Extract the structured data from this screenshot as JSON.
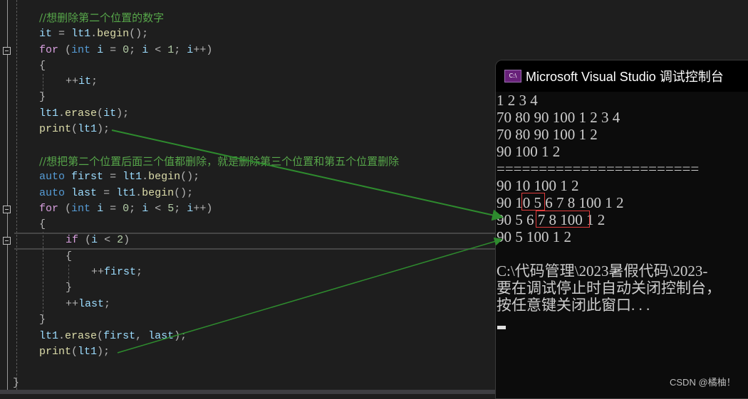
{
  "editor": {
    "lines": [
      {
        "comment": "//想删除第二个位置的数字"
      },
      {
        "code": "it = lt1.begin();"
      },
      {
        "code": "for (int i = 0; i < 1; i++)"
      },
      {
        "code": "{"
      },
      {
        "code": "++it;"
      },
      {
        "code": "}"
      },
      {
        "code": "lt1.erase(it);"
      },
      {
        "code": "print(lt1);"
      },
      {
        "code": ""
      },
      {
        "comment": "//想把第二个位置后面三个值都删除，就是删除第三个位置和第五个位置删除"
      },
      {
        "code": "auto first = lt1.begin();"
      },
      {
        "code": "auto last = lt1.begin();"
      },
      {
        "code": "for (int i = 0; i < 5; i++)"
      },
      {
        "code": "{"
      },
      {
        "code": "if (i < 2)"
      },
      {
        "code": "{"
      },
      {
        "code": "++first;"
      },
      {
        "code": "}"
      },
      {
        "code": "++last;"
      },
      {
        "code": "}"
      },
      {
        "code": "lt1.erase(first, last);"
      },
      {
        "code": "print(lt1);"
      },
      {
        "code": ""
      },
      {
        "code": "}"
      }
    ]
  },
  "console": {
    "title": "Microsoft Visual Studio 调试控制台",
    "icon_label": "C:\\",
    "output": [
      "1 2 3 4",
      "70 80 90 100 1 2 3 4",
      "70 80 90 100 1 2",
      "90 100 1 2",
      "========================",
      "90 10 100 1 2",
      "90 10 5 6 7 8 100 1 2",
      "90 5 6 7 8 100 1 2",
      "90 5 100 1 2",
      "",
      "C:\\代码管理\\2023暑假代码\\2023-",
      "要在调试停止时自动关闭控制台，",
      "按任意键关闭此窗口. . ."
    ]
  },
  "watermark": "CSDN @橘柚！",
  "colors": {
    "highlight_box": "#e03c3c",
    "arrow": "#2e8b2e",
    "comment": "#57a64a"
  }
}
